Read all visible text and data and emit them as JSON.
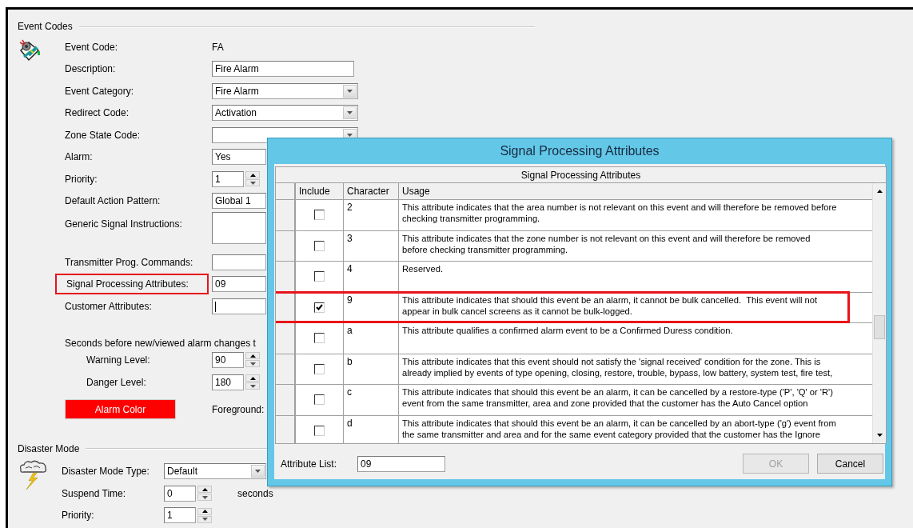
{
  "event_codes": {
    "title": "Event Codes",
    "fields": [
      {
        "label": "Event Code:",
        "kind": "text",
        "value": "FA"
      },
      {
        "label": "Description:",
        "kind": "input",
        "value": "Fire Alarm"
      },
      {
        "label": "Event Category:",
        "kind": "dropdown",
        "value": "Fire Alarm"
      },
      {
        "label": "Redirect Code:",
        "kind": "dropdown",
        "value": "Activation"
      },
      {
        "label": "Zone State Code:",
        "kind": "dropdown"
      },
      {
        "label": "Alarm:",
        "kind": "wide",
        "value": "Yes"
      },
      {
        "label": "Priority:",
        "kind": "spinner",
        "value": "1"
      },
      {
        "label": "Default Action Pattern:",
        "kind": "wide",
        "value": "Global 1"
      },
      {
        "label": "Generic Signal Instructions:",
        "kind": "textarea"
      },
      {
        "label": "Transmitter Prog. Commands:",
        "kind": "wide"
      },
      {
        "label": "Signal Processing Attributes:",
        "kind": "wide",
        "value": "09",
        "highlighted": true
      },
      {
        "label": "Customer Attributes:",
        "kind": "wide",
        "focused": true
      }
    ],
    "note": "Seconds before new/viewed alarm changes t",
    "levels": [
      {
        "label": "Warning Level:",
        "value": "90"
      },
      {
        "label": "Danger Level:",
        "value": "180"
      }
    ],
    "alarm_color_button": "Alarm Color",
    "foreground_label": "Foreground:"
  },
  "disaster_mode": {
    "title": "Disaster Mode",
    "fields": [
      {
        "label": "Disaster Mode Type:",
        "kind": "dropdown",
        "value": "Default"
      },
      {
        "label": "Suspend Time:",
        "kind": "spinner",
        "value": "0",
        "unit": "seconds"
      },
      {
        "label": "Priority:",
        "kind": "spinner",
        "value": "1"
      }
    ]
  },
  "dialog": {
    "title": "Signal Processing Attributes",
    "grid_title": "Signal Processing Attributes",
    "columns": [
      "Include",
      "Character",
      "Usage"
    ],
    "rows": [
      {
        "include": false,
        "character": "2",
        "highlighted": false,
        "usage": [
          "This attribute indicates that the area number is not relevant on this event and will therefore be removed before",
          "checking transmitter programming."
        ]
      },
      {
        "include": false,
        "character": "3",
        "highlighted": false,
        "usage": [
          "This attribute indicates that the zone number is not relevant on this event and will therefore be removed",
          "before checking transmitter programming."
        ]
      },
      {
        "include": false,
        "character": "4",
        "highlighted": false,
        "usage": [
          "Reserved."
        ]
      },
      {
        "include": true,
        "character": "9",
        "highlighted": true,
        "usage": [
          "This attribute indicates that should this event be an alarm, it cannot be bulk cancelled.  This event will not",
          "appear in bulk cancel screens as it cannot be bulk-logged."
        ]
      },
      {
        "include": false,
        "character": "a",
        "highlighted": false,
        "usage": [
          "This attribute qualifies a confirmed alarm event to be a Confirmed Duress condition."
        ]
      },
      {
        "include": false,
        "character": "b",
        "highlighted": false,
        "usage": [
          "This attribute indicates that this event should not satisfy the 'signal received' condition for the zone. This is",
          "already implied by events of type opening, closing, restore, trouble, bypass, low battery, system test, fire test,"
        ]
      },
      {
        "include": false,
        "character": "c",
        "highlighted": false,
        "usage": [
          "This attribute indicates that should this event be an alarm, it can be cancelled by a restore-type ('P', 'Q' or 'R')",
          "event from the same transmitter, area and zone provided that the customer has the Auto Cancel option"
        ]
      },
      {
        "include": false,
        "character": "d",
        "highlighted": false,
        "usage": [
          "This attribute indicates that should this event be an alarm, it can be cancelled by an abort-type ('g') event from",
          "the same transmitter and area and for the same event category provided that the customer has the Ignore"
        ]
      }
    ],
    "attribute_list_label": "Attribute List:",
    "attribute_list_value": "09",
    "buttons": [
      {
        "label": "OK",
        "disabled": true
      },
      {
        "label": "Cancel",
        "disabled": false
      }
    ]
  }
}
